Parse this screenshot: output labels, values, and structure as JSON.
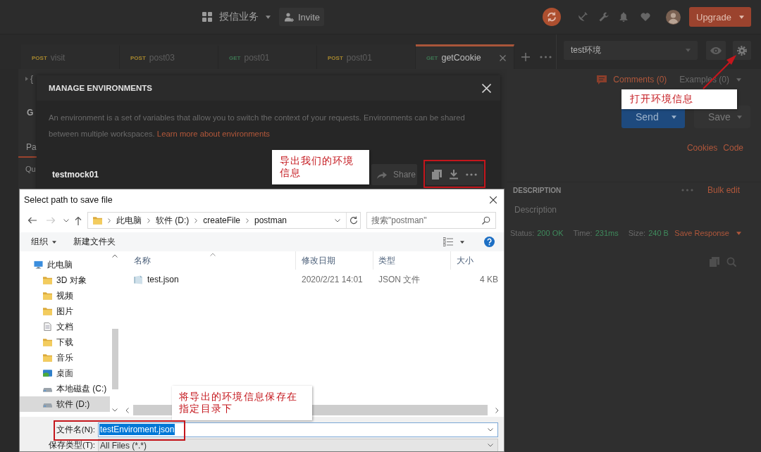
{
  "top_bar": {
    "workspace": "授信业务",
    "invite": "Invite",
    "upgrade": "Upgrade"
  },
  "tabs": [
    {
      "method": "POST",
      "color": "#a5862e",
      "name": "visit",
      "selected": false
    },
    {
      "method": "POST",
      "color": "#a5862e",
      "name": "post03",
      "selected": false
    },
    {
      "method": "GET",
      "color": "#3d7552",
      "name": "post01",
      "selected": false
    },
    {
      "method": "POST",
      "color": "#a5862e",
      "name": "post01",
      "selected": false
    },
    {
      "method": "GET",
      "color": "#3d7552",
      "name": "getCookie",
      "selected": true
    }
  ],
  "environment": {
    "value": "test环境"
  },
  "request": {
    "name_cut": "{",
    "method_cut": "G",
    "tabs": [
      {
        "label": "Pa",
        "selected": true
      }
    ],
    "section_cut": "Qu",
    "comments": "Comments (0)",
    "examples": "Examples (0)",
    "send": "Send",
    "save": "Save",
    "links": [
      "Cookies",
      "Code"
    ],
    "description_header": "DESCRIPTION",
    "bulk_edit": "Bulk edit",
    "description_placeholder": "Description"
  },
  "response": {
    "status_label": "Status:",
    "status": "200 OK",
    "time_label": "Time:",
    "time": "231ms",
    "size_label": "Size:",
    "size": "240 B",
    "save_response": "Save Response"
  },
  "manage_environments": {
    "title": "MANAGE ENVIRONMENTS",
    "description": "An environment is a set of variables that allow you to switch the context of your requests. Environments can be shared between multiple workspaces.",
    "link": "Learn more about environments",
    "environments": [
      {
        "name": "testmock01",
        "share": "Share"
      }
    ]
  },
  "save_dialog": {
    "title": "Select path to save file",
    "forward_disabled": true,
    "breadcrumb": [
      "此电脑",
      "软件 (D:)",
      "createFile",
      "postman"
    ],
    "search_placeholder": "搜索\"postman\"",
    "organize": "组织",
    "new_folder": "新建文件夹",
    "nav_tree": [
      {
        "label": "此电脑",
        "selected": false,
        "children": [
          {
            "label": "3D 对象",
            "selected": false
          },
          {
            "label": "视频",
            "selected": false
          },
          {
            "label": "图片",
            "selected": false
          },
          {
            "label": "文档",
            "selected": false
          },
          {
            "label": "下载",
            "selected": false
          },
          {
            "label": "音乐",
            "selected": false
          },
          {
            "label": "桌面",
            "selected": false
          },
          {
            "label": "本地磁盘 (C:)",
            "selected": false
          },
          {
            "label": "软件 (D:)",
            "selected": true
          }
        ]
      }
    ],
    "columns": [
      "名称",
      "修改日期",
      "类型",
      "大小"
    ],
    "files": [
      {
        "name": "test.json",
        "modified": "2020/2/21 14:01",
        "type": "JSON 文件",
        "size": "4 KB"
      }
    ],
    "file_name_label": "文件名(N):",
    "file_name": "testEnviroment.json",
    "file_name_selected": true,
    "file_type_label": "保存类型(T):",
    "file_type": "All Files (*.*)"
  },
  "annotations": [
    {
      "text": "打开环境信息"
    },
    {
      "text": "导出我们的环境信息"
    },
    {
      "text": "将导出的环境信息保存在指定目录下"
    }
  ]
}
